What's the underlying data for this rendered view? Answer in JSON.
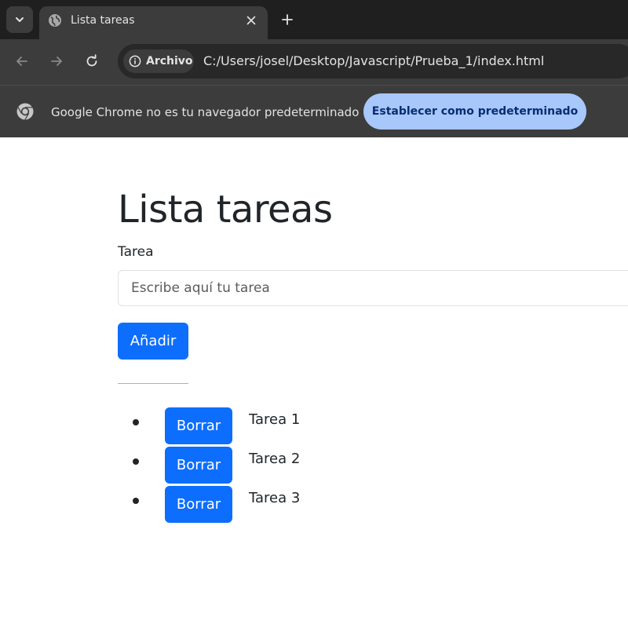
{
  "browser": {
    "tab": {
      "title": "Lista tareas"
    },
    "address_bar": {
      "chip_label": "Archivo",
      "url": "C:/Users/josel/Desktop/Javascript/Prueba_1/index.html"
    },
    "infobar": {
      "message": "Google Chrome no es tu navegador predeterminado",
      "button_label": "Establecer como predeterminado"
    }
  },
  "page": {
    "title": "Lista tareas",
    "field_label": "Tarea",
    "input": {
      "placeholder": "Escribe aquí tu tarea",
      "value": ""
    },
    "add_button_label": "Añadir",
    "tasks": [
      {
        "delete_label": "Borrar",
        "text": "Tarea 1"
      },
      {
        "delete_label": "Borrar",
        "text": "Tarea 2"
      },
      {
        "delete_label": "Borrar",
        "text": "Tarea 3"
      }
    ]
  },
  "colors": {
    "primary_button": "#0d6efd",
    "infobar_button": "#a8c7fa",
    "chrome_dark": "#3c3c3c",
    "tabstrip": "#1f1f1f"
  },
  "icons": [
    "chevron-down-icon",
    "globe-icon",
    "close-icon",
    "plus-icon",
    "back-arrow-icon",
    "forward-arrow-icon",
    "reload-icon",
    "info-icon",
    "chrome-logo-icon"
  ]
}
